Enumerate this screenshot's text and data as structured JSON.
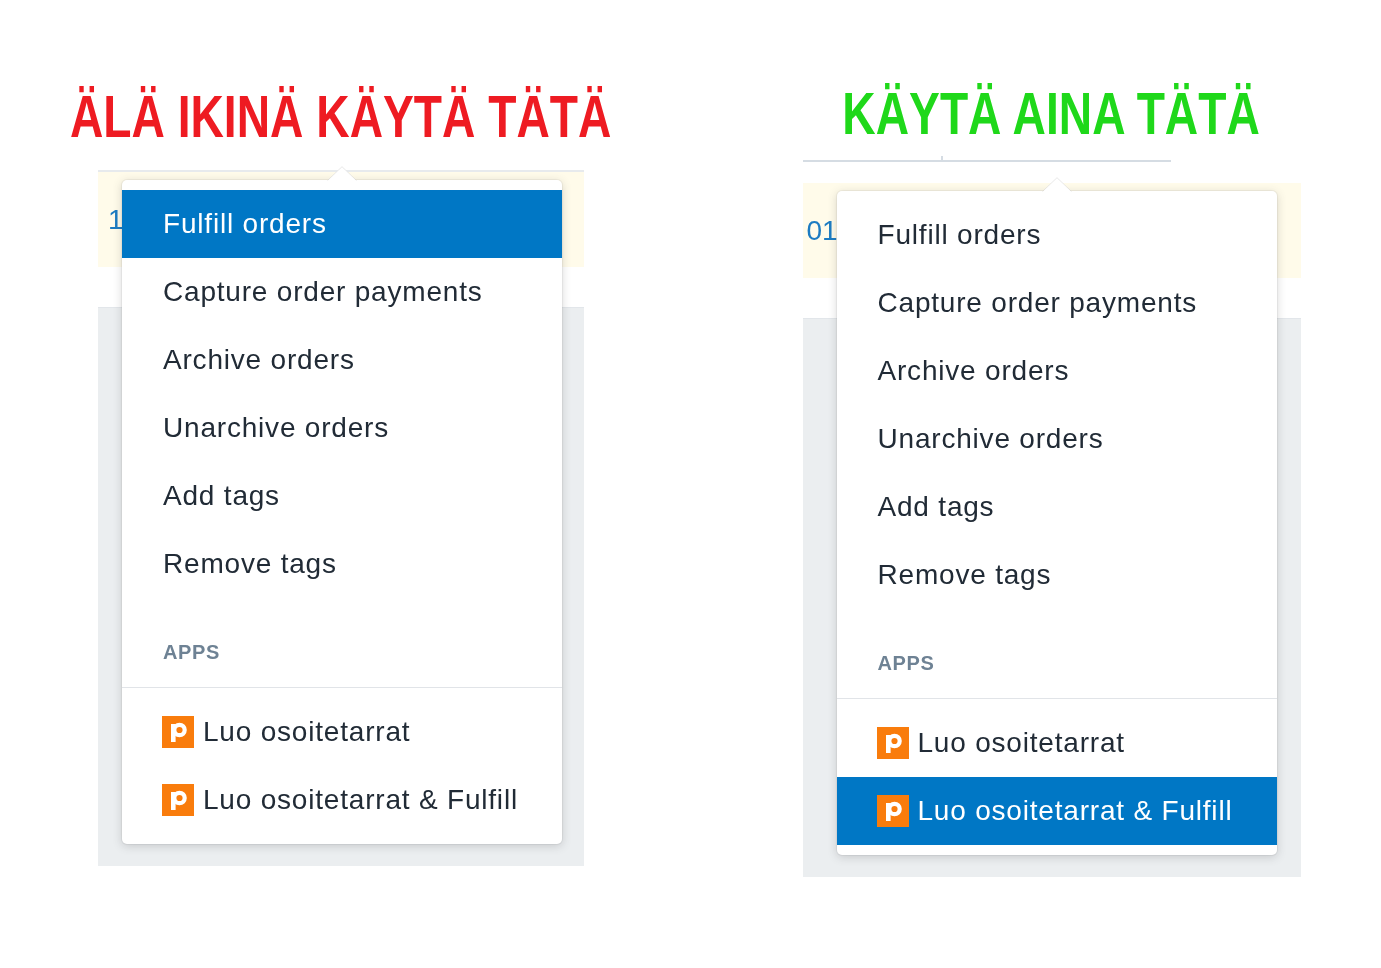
{
  "panels": [
    {
      "heading": {
        "text": "ÄLÄ IKINÄ KÄYTÄ TÄTÄ",
        "color": "#ee1b22"
      },
      "tab_underline": false,
      "row_text": "1",
      "menu": {
        "items": [
          {
            "label": "Fulfill orders",
            "selected": true
          },
          {
            "label": "Capture order payments",
            "selected": false
          },
          {
            "label": "Archive orders",
            "selected": false
          },
          {
            "label": "Unarchive orders",
            "selected": false
          },
          {
            "label": "Add tags",
            "selected": false
          },
          {
            "label": "Remove tags",
            "selected": false
          }
        ],
        "section_title": "APPS",
        "app_items": [
          {
            "label": "Luo osoitetarrat",
            "selected": false
          },
          {
            "label": "Luo osoitetarrat & Fulfill",
            "selected": false
          }
        ]
      }
    },
    {
      "heading": {
        "text": "KÄYTÄ AINA TÄTÄ",
        "color": "#1fd81a"
      },
      "tab_underline": true,
      "row_text": "01",
      "menu": {
        "items": [
          {
            "label": "Fulfill orders",
            "selected": false
          },
          {
            "label": "Capture order payments",
            "selected": false
          },
          {
            "label": "Archive orders",
            "selected": false
          },
          {
            "label": "Unarchive orders",
            "selected": false
          },
          {
            "label": "Add tags",
            "selected": false
          },
          {
            "label": "Remove tags",
            "selected": false
          }
        ],
        "section_title": "APPS",
        "app_items": [
          {
            "label": "Luo osoitetarrat",
            "selected": false
          },
          {
            "label": "Luo osoitetarrat & Fulfill",
            "selected": true
          }
        ]
      }
    }
  ]
}
